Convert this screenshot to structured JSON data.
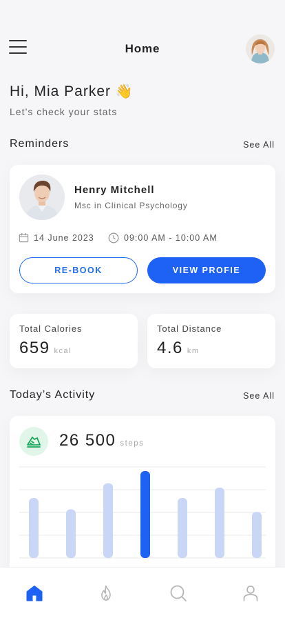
{
  "header": {
    "title": "Home"
  },
  "greeting": {
    "text": "Hi, Mia Parker",
    "emoji": "👋",
    "subtitle": "Let’s check your stats"
  },
  "reminders": {
    "title": "Reminders",
    "see_all": "See All",
    "card": {
      "name": "Henry Mitchell",
      "title": "Msc in Clinical Psychology",
      "date": "14 June 2023",
      "time": "09:00 AM - 10:00 AM",
      "rebook_label": "RE-BOOK",
      "view_label": "VIEW PROFIE"
    }
  },
  "stats": {
    "calories": {
      "label": "Total Calories",
      "value": "659",
      "unit": "kcal"
    },
    "distance": {
      "label": "Total Distance",
      "value": "4.6",
      "unit": "km"
    }
  },
  "activity": {
    "title": "Today’s Activity",
    "see_all": "See All",
    "steps_value": "26 500",
    "steps_unit": "steps"
  },
  "chart_data": {
    "type": "bar",
    "values": [
      0.69,
      0.56,
      0.86,
      1.0,
      0.69,
      0.81,
      0.53
    ],
    "highlight_index": 3,
    "colors": {
      "bar": "#c9d6f5",
      "highlight": "#1e62f5"
    }
  },
  "nav": {
    "items": [
      "home",
      "fire",
      "search",
      "profile"
    ],
    "active": "home",
    "colors": {
      "active": "#1e62f5",
      "inactive": "#b5b5b5"
    }
  }
}
